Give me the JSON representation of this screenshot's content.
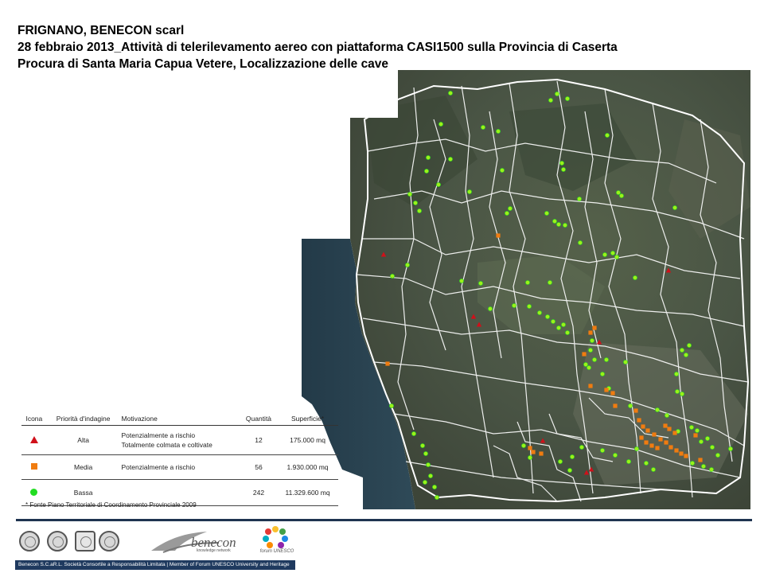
{
  "title": {
    "line1": "FRIGNANO, BENECON scarl",
    "line2": "28 febbraio 2013_Attività di telerilevamento aereo con piattaforma CASI1500 sulla Provincia di Caserta",
    "line3": "Procura di Santa Maria Capua Vetere, Localizzazione delle cave"
  },
  "legend": {
    "headers": [
      "Icona",
      "Priorità d'indagine",
      "Motivazione",
      "Quantità",
      "Superficie*"
    ],
    "rows": [
      {
        "icon": "red-triangle",
        "priority": "Alta",
        "motivation_1": "Potenzialmente a rischio",
        "motivation_2": "Totalmente colmata e coltivate",
        "quantity": "12",
        "surface": "175.000 mq"
      },
      {
        "icon": "orange-square",
        "priority": "Media",
        "motivation_1": "Potenzialmente a rischio",
        "motivation_2": "",
        "quantity": "56",
        "surface": "1.930.000 mq"
      },
      {
        "icon": "green-circle",
        "priority": "Bassa",
        "motivation_1": "",
        "motivation_2": "",
        "quantity": "242",
        "surface": "11.329.600 mq"
      }
    ],
    "note": "* Fonte Piano Territoriale di Coordinamento Provinciale 2009"
  },
  "footer": {
    "bar_text": "Benecon S.C.aR.L. Società Consortile a Responsabilità Limitata | Member of Forum UNESCO University and Heritage",
    "benecon_word": "benecon",
    "benecon_sub": "knowledge network",
    "forum_label": "forum UNESCO"
  },
  "colors": {
    "high": "#d0101a",
    "medium": "#f07c10",
    "low": "#22dd22",
    "footer_bar": "#1f3a5f"
  },
  "map_markers": {
    "low": [
      [
        566,
        117
      ],
      [
        700,
        118
      ],
      [
        692,
        126
      ],
      [
        713,
        124
      ],
      [
        554,
        156
      ],
      [
        607,
        160
      ],
      [
        626,
        165
      ],
      [
        763,
        170
      ],
      [
        538,
        198
      ],
      [
        566,
        200
      ],
      [
        631,
        214
      ],
      [
        706,
        205
      ],
      [
        708,
        213
      ],
      [
        536,
        215
      ],
      [
        551,
        232
      ],
      [
        590,
        241
      ],
      [
        515,
        244
      ],
      [
        522,
        255
      ],
      [
        527,
        265
      ],
      [
        641,
        262
      ],
      [
        637,
        268
      ],
      [
        687,
        268
      ],
      [
        728,
        250
      ],
      [
        777,
        242
      ],
      [
        781,
        246
      ],
      [
        848,
        261
      ],
      [
        697,
        278
      ],
      [
        702,
        282
      ],
      [
        710,
        283
      ],
      [
        729,
        305
      ],
      [
        770,
        318
      ],
      [
        775,
        323
      ],
      [
        760,
        320
      ],
      [
        798,
        349
      ],
      [
        512,
        333
      ],
      [
        493,
        347
      ],
      [
        580,
        353
      ],
      [
        604,
        356
      ],
      [
        663,
        355
      ],
      [
        691,
        355
      ],
      [
        616,
        388
      ],
      [
        646,
        384
      ],
      [
        665,
        385
      ],
      [
        678,
        393
      ],
      [
        688,
        398
      ],
      [
        695,
        404
      ],
      [
        708,
        408
      ],
      [
        702,
        412
      ],
      [
        713,
        418
      ],
      [
        744,
        428
      ],
      [
        742,
        440
      ],
      [
        736,
        458
      ],
      [
        740,
        462
      ],
      [
        747,
        452
      ],
      [
        757,
        470
      ],
      [
        762,
        452
      ],
      [
        786,
        455
      ],
      [
        857,
        440
      ],
      [
        862,
        446
      ],
      [
        866,
        434
      ],
      [
        851,
        492
      ],
      [
        857,
        495
      ],
      [
        850,
        470
      ],
      [
        765,
        488
      ],
      [
        792,
        510
      ],
      [
        826,
        515
      ],
      [
        838,
        522
      ],
      [
        852,
        542
      ],
      [
        869,
        537
      ],
      [
        876,
        541
      ],
      [
        881,
        555
      ],
      [
        889,
        551
      ],
      [
        895,
        562
      ],
      [
        902,
        572
      ],
      [
        918,
        564
      ],
      [
        870,
        582
      ],
      [
        884,
        586
      ],
      [
        894,
        590
      ],
      [
        531,
        560
      ],
      [
        535,
        570
      ],
      [
        538,
        584
      ],
      [
        541,
        598
      ],
      [
        546,
        612
      ],
      [
        549,
        625
      ],
      [
        520,
        545
      ],
      [
        534,
        606
      ],
      [
        492,
        510
      ],
      [
        658,
        560
      ],
      [
        666,
        575
      ],
      [
        704,
        580
      ],
      [
        716,
        591
      ],
      [
        719,
        574
      ],
      [
        731,
        562
      ],
      [
        757,
        566
      ],
      [
        773,
        572
      ],
      [
        790,
        580
      ],
      [
        800,
        564
      ],
      [
        812,
        582
      ],
      [
        821,
        590
      ]
    ],
    "medium": [
      [
        626,
        296
      ],
      [
        742,
        418
      ],
      [
        747,
        412
      ],
      [
        734,
        445
      ],
      [
        742,
        485
      ],
      [
        762,
        490
      ],
      [
        770,
        494
      ],
      [
        773,
        510
      ],
      [
        799,
        516
      ],
      [
        803,
        528
      ],
      [
        808,
        536
      ],
      [
        814,
        541
      ],
      [
        822,
        546
      ],
      [
        830,
        552
      ],
      [
        837,
        556
      ],
      [
        843,
        562
      ],
      [
        850,
        566
      ],
      [
        856,
        570
      ],
      [
        862,
        573
      ],
      [
        806,
        550
      ],
      [
        812,
        556
      ],
      [
        819,
        560
      ],
      [
        826,
        563
      ],
      [
        836,
        535
      ],
      [
        841,
        539
      ],
      [
        848,
        544
      ],
      [
        874,
        547
      ],
      [
        880,
        578
      ],
      [
        666,
        563
      ],
      [
        670,
        568
      ],
      [
        680,
        570
      ],
      [
        487,
        457
      ]
    ],
    "high": [
      [
        482,
        320
      ],
      [
        840,
        340
      ],
      [
        595,
        398
      ],
      [
        602,
        408
      ],
      [
        753,
        430
      ],
      [
        682,
        554
      ],
      [
        737,
        594
      ],
      [
        743,
        590
      ]
    ]
  }
}
